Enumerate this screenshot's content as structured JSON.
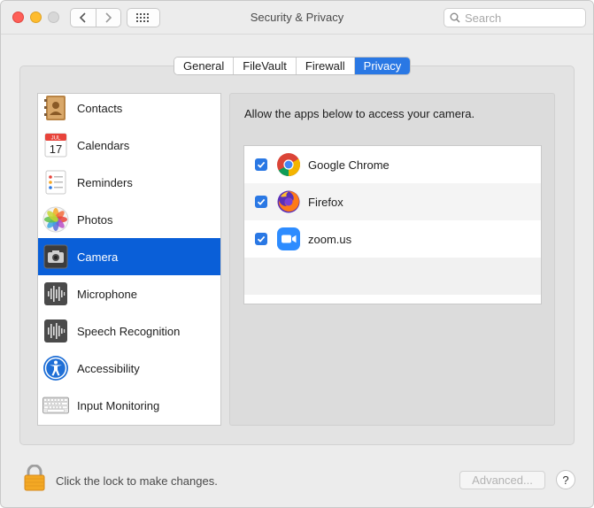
{
  "window": {
    "title": "Security & Privacy",
    "search_placeholder": "Search"
  },
  "tabs": [
    {
      "label": "General",
      "active": false
    },
    {
      "label": "FileVault",
      "active": false
    },
    {
      "label": "Firewall",
      "active": false
    },
    {
      "label": "Privacy",
      "active": true
    }
  ],
  "categories": [
    {
      "label": "Contacts",
      "icon": "contacts-icon"
    },
    {
      "label": "Calendars",
      "icon": "calendar-icon",
      "icon_text": {
        "month": "JUL",
        "day": "17"
      }
    },
    {
      "label": "Reminders",
      "icon": "reminders-icon"
    },
    {
      "label": "Photos",
      "icon": "photos-icon"
    },
    {
      "label": "Camera",
      "icon": "camera-icon",
      "selected": true
    },
    {
      "label": "Microphone",
      "icon": "microphone-icon"
    },
    {
      "label": "Speech Recognition",
      "icon": "speech-recognition-icon"
    },
    {
      "label": "Accessibility",
      "icon": "accessibility-icon"
    },
    {
      "label": "Input Monitoring",
      "icon": "keyboard-icon"
    }
  ],
  "privacy_panel": {
    "description": "Allow the apps below to access your camera.",
    "apps": [
      {
        "name": "Google Chrome",
        "checked": true,
        "icon": "chrome-icon"
      },
      {
        "name": "Firefox",
        "checked": true,
        "icon": "firefox-icon"
      },
      {
        "name": "zoom.us",
        "checked": true,
        "icon": "zoom-icon"
      }
    ]
  },
  "footer": {
    "lock_text": "Click the lock to make changes.",
    "advanced_label": "Advanced...",
    "help_label": "?"
  },
  "colors": {
    "accent": "#2a78e4",
    "selection": "#0a5fd8",
    "close": "#fe5f57",
    "minimize": "#febc2e"
  }
}
